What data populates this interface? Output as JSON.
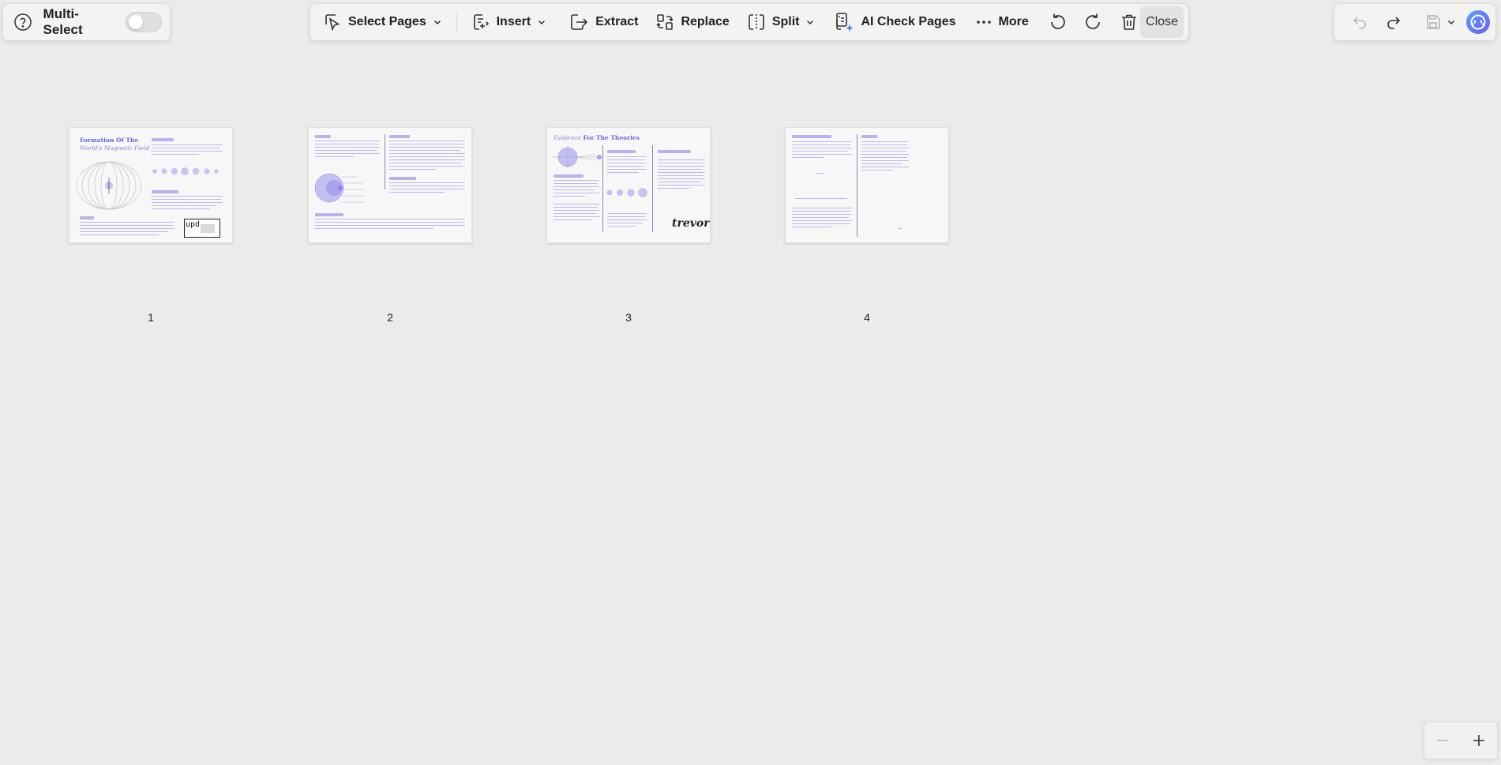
{
  "left_panel": {
    "multi_select_label": "Multi-Select",
    "multi_select_on": false
  },
  "toolbar": {
    "select_pages_label": "Select Pages",
    "insert_label": "Insert",
    "extract_label": "Extract",
    "replace_label": "Replace",
    "split_label": "Split",
    "ai_check_label": "AI Check Pages",
    "more_label": "More",
    "close_label": "Close"
  },
  "pages": [
    {
      "number": "1",
      "title_line1": "Formation Of The",
      "title_line2": "World's Magnetic Field",
      "stamp": "upd"
    },
    {
      "number": "2"
    },
    {
      "number": "3",
      "title_italic": "Evidence",
      "title_rest": " For The Theories",
      "signature": "trevor"
    },
    {
      "number": "4"
    }
  ],
  "colors": {
    "accent": "#6b63d9",
    "background": "#ebebe9",
    "assistant": "#4f7df0"
  },
  "icons": {
    "help": "question-circle-icon",
    "undo": "undo-icon",
    "redo": "redo-icon",
    "delete": "trash-icon",
    "save": "save-icon",
    "assistant": "ai-assistant-icon"
  }
}
